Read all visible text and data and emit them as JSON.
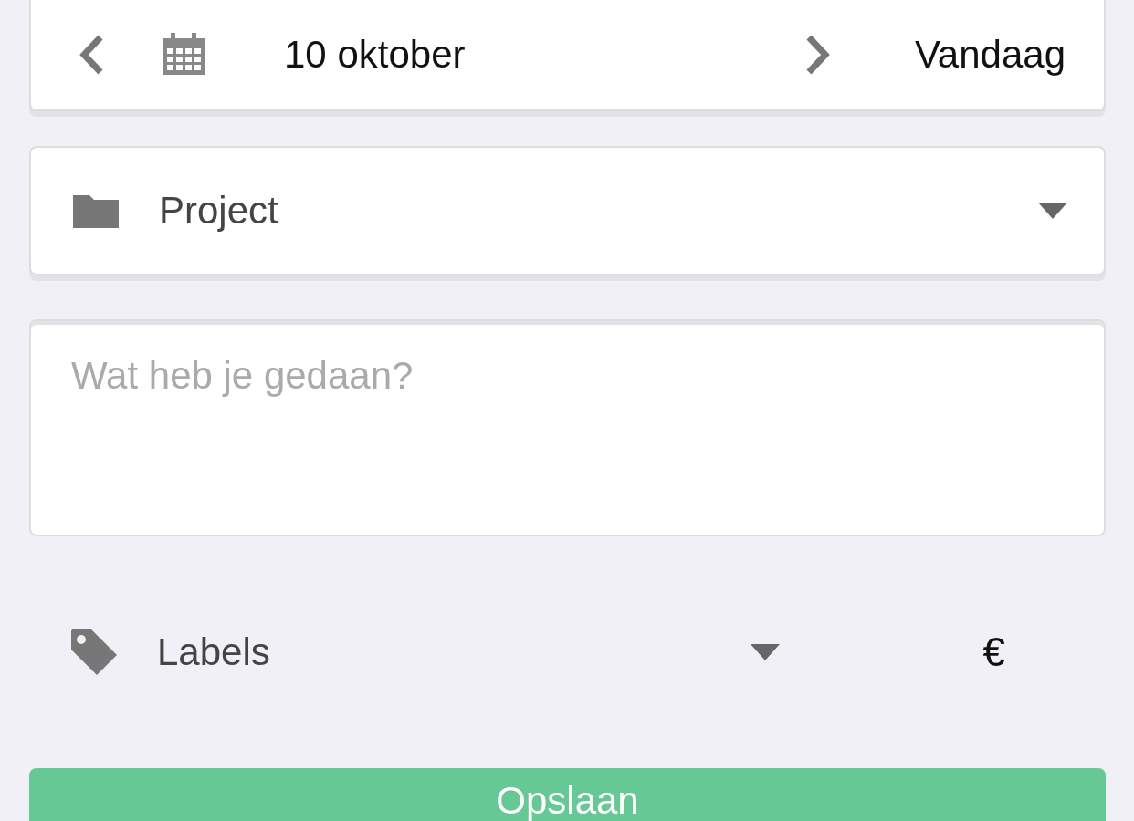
{
  "date_bar": {
    "date": "10 oktober",
    "today_button": "Vandaag"
  },
  "project": {
    "label": "Project"
  },
  "description": {
    "placeholder": "Wat heb je gedaan?"
  },
  "labels": {
    "label": "Labels",
    "currency": "€"
  },
  "save_button": "Opslaan"
}
